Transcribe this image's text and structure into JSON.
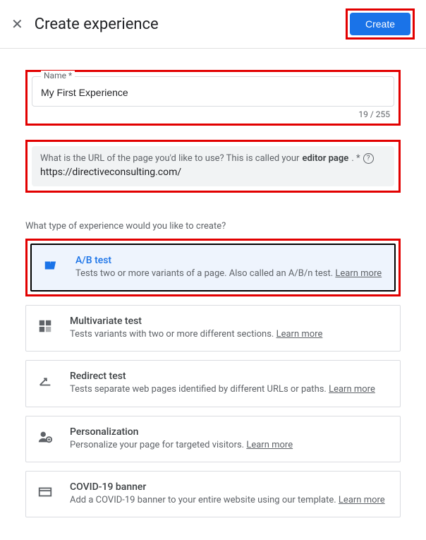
{
  "header": {
    "title": "Create experience",
    "create_label": "Create"
  },
  "name_field": {
    "label": "Name *",
    "value": "My First Experience",
    "counter": "19 / 255"
  },
  "url_field": {
    "prompt_pre": "What is the URL of the page you'd like to use? This is called your ",
    "prompt_bold": "editor page",
    "prompt_post": ". *",
    "value": "https://directiveconsulting.com/"
  },
  "type_question": "What type of experience would you like to create?",
  "learn_more": "Learn more",
  "options": {
    "ab": {
      "title": "A/B test",
      "desc": "Tests two or more variants of a page. Also called an A/B/n test. "
    },
    "multi": {
      "title": "Multivariate test",
      "desc": "Tests variants with two or more different sections. "
    },
    "redirect": {
      "title": "Redirect test",
      "desc": "Tests separate web pages identified by different URLs or paths. "
    },
    "personal": {
      "title": "Personalization",
      "desc": "Personalize your page for targeted visitors. "
    },
    "covid": {
      "title": "COVID-19 banner",
      "desc": "Add a COVID-19 banner to your entire website using our template. "
    }
  }
}
